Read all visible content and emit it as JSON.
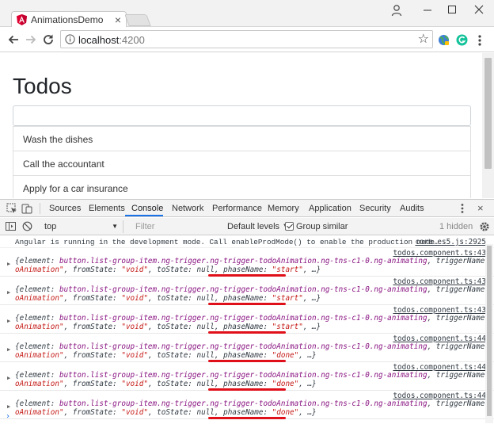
{
  "window": {
    "tab_title": "AnimationsDemo",
    "tab_close": "×"
  },
  "toolbar": {
    "url_host": "localhost",
    "url_port": ":4200",
    "bookmark_glyph": "☆"
  },
  "page": {
    "title": "Todos",
    "input_value": "",
    "todos": [
      "Wash the dishes",
      "Call the accountant",
      "Apply for a car insurance"
    ]
  },
  "devtools": {
    "tabs": [
      "Sources",
      "Elements",
      "Console",
      "Network",
      "Performance",
      "Memory",
      "Application",
      "Security",
      "Audits"
    ],
    "active_tab": "Console",
    "close_glyph": "×",
    "console_bar": {
      "context": "top",
      "filter_placeholder": "Filter",
      "levels": "Default levels ▼",
      "group_similar": "Group similar",
      "group_similar_checked": true,
      "hidden_count": "1 hidden"
    },
    "console": {
      "info_message": "Angular is running in the development mode. Call enableProdMode() to enable the production mode.",
      "info_source": "core.es5.js:2925",
      "entries": [
        {
          "source": "todos.component.ts:43",
          "phase": "\"start\""
        },
        {
          "source": "todos.component.ts:43",
          "phase": "\"start\""
        },
        {
          "source": "todos.component.ts:43",
          "phase": "\"start\""
        },
        {
          "source": "todos.component.ts:44",
          "phase": "\"done\""
        },
        {
          "source": "todos.component.ts:44",
          "phase": "\"done\""
        },
        {
          "source": "todos.component.ts:44",
          "phase": "\"done\""
        }
      ],
      "entry_text": {
        "open": "{element: ",
        "element": "button.list-group-item.ng-trigger.ng-trigger-todoAnimation.ng-tns-c1-0.ng-animating",
        "trigger_key": ", triggerName: ",
        "trigger_a": "\"tod",
        "trigger_b": "oAnimation\"",
        "from_key": ", fromState: ",
        "from_val": "\"void\"",
        "to_key": ", toState: ",
        "to_val": "null",
        "phase_key": ", phaseName: ",
        "close": ", …}"
      },
      "prompt": "›"
    }
  },
  "colors": {
    "highlight_underline": "#e0101a",
    "angular_red": "#dd0031",
    "devtools_blue": "#1a73e8"
  }
}
